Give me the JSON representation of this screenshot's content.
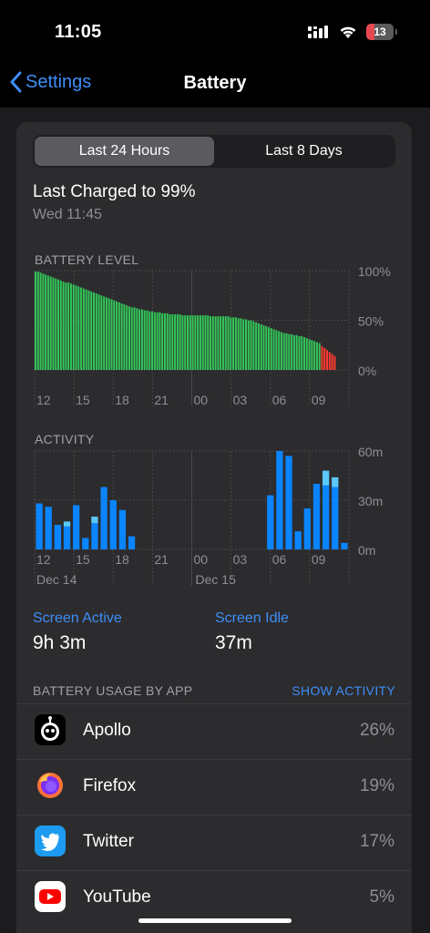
{
  "status": {
    "time": "11:05",
    "battery_level": "13"
  },
  "nav": {
    "back_label": "Settings",
    "title": "Battery"
  },
  "segments": [
    "Last 24 Hours",
    "Last 8 Days"
  ],
  "selected_segment": "Last 24 Hours",
  "last_charged": {
    "title": "Last Charged to 99%",
    "time": "Wed 11:45"
  },
  "battery_level_chart": {
    "label": "BATTERY LEVEL",
    "y_ticks": [
      "100%",
      "50%",
      "0%"
    ],
    "x_ticks": [
      "12",
      "15",
      "18",
      "21",
      "00",
      "03",
      "06",
      "09"
    ]
  },
  "activity_chart": {
    "label": "ACTIVITY",
    "y_ticks": [
      "60m",
      "30m",
      "0m"
    ],
    "x_ticks": [
      "12",
      "15",
      "18",
      "21",
      "00",
      "03",
      "06",
      "09"
    ],
    "date_labels": [
      "Dec 14",
      "Dec 15"
    ]
  },
  "chart_data": [
    {
      "type": "bar",
      "title": "BATTERY LEVEL",
      "ylim": [
        0,
        100
      ],
      "y_unit": "%",
      "values": [
        99,
        99,
        98,
        97,
        96,
        95,
        94,
        93,
        92,
        91,
        90,
        89,
        88,
        88,
        87,
        86,
        85,
        84,
        83,
        82,
        81,
        80,
        79,
        78,
        77,
        76,
        75,
        74,
        73,
        72,
        71,
        70,
        69,
        68,
        67,
        66,
        65,
        64,
        63,
        63,
        62,
        61,
        61,
        60,
        60,
        59,
        59,
        58,
        58,
        58,
        57,
        57,
        57,
        56,
        56,
        56,
        56,
        56,
        55,
        55,
        55,
        55,
        55,
        55,
        55,
        55,
        55,
        55,
        55,
        54,
        54,
        54,
        54,
        54,
        54,
        54,
        54,
        53,
        53,
        53,
        52,
        52,
        51,
        51,
        50,
        50,
        49,
        48,
        47,
        46,
        45,
        44,
        43,
        42,
        41,
        40,
        39,
        38,
        37,
        37,
        36,
        36,
        35,
        35,
        34,
        34,
        33,
        32,
        31,
        30,
        29,
        28,
        27,
        24,
        22,
        20,
        18,
        16,
        14
      ],
      "low_threshold_from_index": 113,
      "colors": {
        "normal": "#34c759",
        "low": "#ff3b30"
      }
    },
    {
      "type": "bar",
      "title": "ACTIVITY",
      "ylim": [
        0,
        60
      ],
      "y_unit": "minutes",
      "series": [
        {
          "name": "Screen On",
          "color": "#0a84ff"
        },
        {
          "name": "Screen Off",
          "color": "#5ac8fa"
        }
      ],
      "bars": [
        {
          "on": 28,
          "off": 0
        },
        {
          "on": 26,
          "off": 0
        },
        {
          "on": 15,
          "off": 0
        },
        {
          "on": 14,
          "off": 3
        },
        {
          "on": 27,
          "off": 0
        },
        {
          "on": 7,
          "off": 0
        },
        {
          "on": 16,
          "off": 4
        },
        {
          "on": 38,
          "off": 0
        },
        {
          "on": 30,
          "off": 0
        },
        {
          "on": 24,
          "off": 0
        },
        {
          "on": 8,
          "off": 0
        },
        {
          "on": 0,
          "off": 0
        },
        {
          "on": 0,
          "off": 0
        },
        {
          "on": 0,
          "off": 0
        },
        {
          "on": 0,
          "off": 0
        },
        {
          "on": 0,
          "off": 0
        },
        {
          "on": 0,
          "off": 0
        },
        {
          "on": 0,
          "off": 0
        },
        {
          "on": 0,
          "off": 0
        },
        {
          "on": 0,
          "off": 0
        },
        {
          "on": 0,
          "off": 0
        },
        {
          "on": 0,
          "off": 0
        },
        {
          "on": 0,
          "off": 0
        },
        {
          "on": 0,
          "off": 0
        },
        {
          "on": 0,
          "off": 0
        },
        {
          "on": 33,
          "off": 0
        },
        {
          "on": 60,
          "off": 0
        },
        {
          "on": 57,
          "off": 0
        },
        {
          "on": 11,
          "off": 0
        },
        {
          "on": 25,
          "off": 0
        },
        {
          "on": 40,
          "off": 0
        },
        {
          "on": 39,
          "off": 9
        },
        {
          "on": 38,
          "off": 6
        },
        {
          "on": 4,
          "off": 0
        }
      ]
    }
  ],
  "stats": {
    "screen_active_label": "Screen Active",
    "screen_active_value": "9h 3m",
    "screen_idle_label": "Screen Idle",
    "screen_idle_value": "37m"
  },
  "usage": {
    "header": "BATTERY USAGE BY APP",
    "show_activity": "SHOW ACTIVITY",
    "apps": [
      {
        "name": "Apollo",
        "percent": "26%",
        "icon": "apollo-icon"
      },
      {
        "name": "Firefox",
        "percent": "19%",
        "icon": "firefox-icon"
      },
      {
        "name": "Twitter",
        "percent": "17%",
        "icon": "twitter-icon"
      },
      {
        "name": "YouTube",
        "percent": "5%",
        "icon": "youtube-icon"
      }
    ]
  }
}
